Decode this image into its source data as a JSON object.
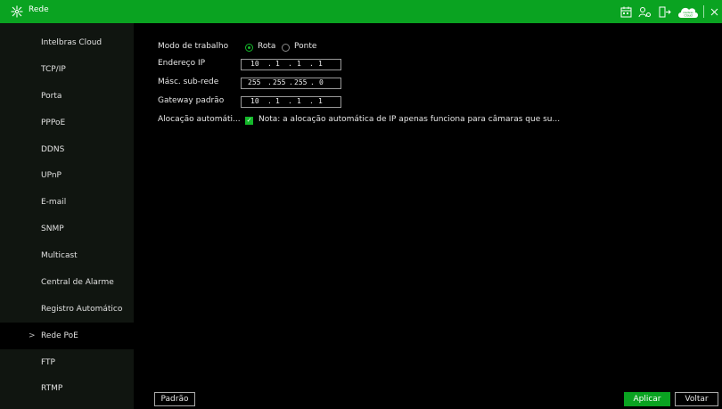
{
  "window": {
    "title": "Rede"
  },
  "sidebar": {
    "items": [
      {
        "label": "Intelbras Cloud"
      },
      {
        "label": "TCP/IP"
      },
      {
        "label": "Porta"
      },
      {
        "label": "PPPoE"
      },
      {
        "label": "DDNS"
      },
      {
        "label": "UPnP"
      },
      {
        "label": "E-mail"
      },
      {
        "label": "SNMP"
      },
      {
        "label": "Multicast"
      },
      {
        "label": "Central de Alarme"
      },
      {
        "label": "Registro Automático"
      },
      {
        "label": "Rede PoE",
        "active": true,
        "chevron": ">"
      },
      {
        "label": "FTP"
      },
      {
        "label": "RTMP"
      }
    ]
  },
  "form": {
    "work_mode_label": "Modo de trabalho",
    "mode_options": [
      "Rota",
      "Ponte"
    ],
    "mode_selected": "Rota",
    "ip_label": "Endereço IP",
    "ip": {
      "o1": "10",
      "o2": "1",
      "o3": "1",
      "o4": "1"
    },
    "mask_label": "Másc. sub-rede",
    "mask": {
      "o1": "255",
      "o2": "255",
      "o3": "255",
      "o4": "0"
    },
    "gateway_label": "Gateway padrão",
    "gateway": {
      "o1": "10",
      "o2": "1",
      "o3": "1",
      "o4": "1"
    },
    "auto_alloc_label": "Alocação automáti...",
    "auto_alloc_checked": true,
    "note": "Nota: a alocação automática de IP apenas funciona para câmaras que su...",
    "dot": "."
  },
  "buttons": {
    "default_label": "Padrão",
    "apply_label": "Aplicar",
    "back_label": "Voltar"
  },
  "icons": {
    "cloud_badge_top": "intelbras",
    "cloud_badge_bottom": "Cloud"
  },
  "colors": {
    "accent": "#0aa321",
    "radio_on": "#14b82a"
  }
}
